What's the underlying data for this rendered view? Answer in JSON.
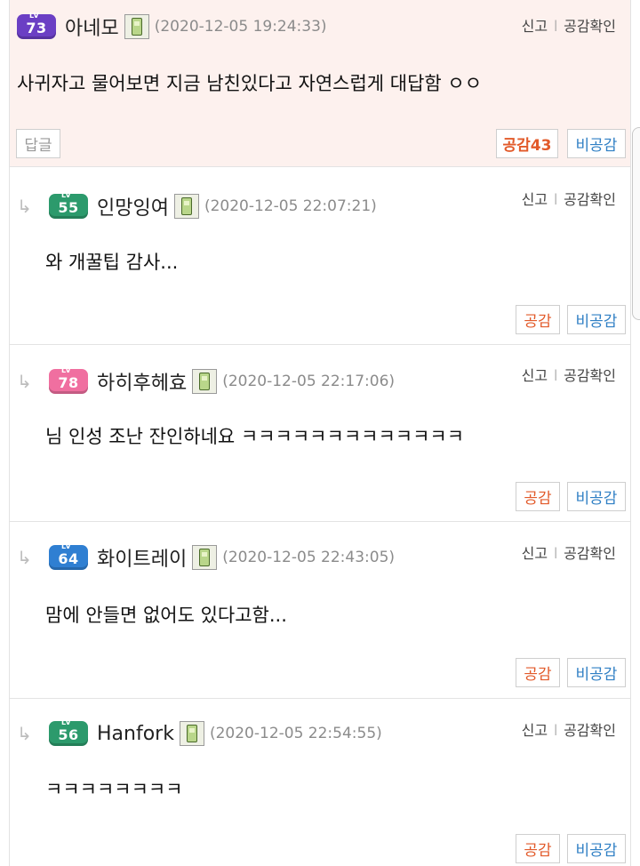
{
  "comments": [
    {
      "level": "73",
      "level_color": "#6b3fc4",
      "nickname": "아네모",
      "date": "(2020-12-05 19:24:33)",
      "report": "신고",
      "sympathy_check": "공감확인",
      "text": "사귀자고 물어보면 지금 남친있다고 자연스럽게 대답함 ㅇㅇ",
      "reply_btn": "답글",
      "like": "공감43",
      "dislike": "비공감"
    },
    {
      "level": "55",
      "level_color": "#2c9a6c",
      "nickname": "인망잉여",
      "date": "(2020-12-05 22:07:21)",
      "report": "신고",
      "sympathy_check": "공감확인",
      "text": "와 개꿀팁 감사...",
      "like": "공감",
      "dislike": "비공감"
    },
    {
      "level": "78",
      "level_color": "#f06fa0",
      "nickname": "하히후헤효",
      "date": "(2020-12-05 22:17:06)",
      "report": "신고",
      "sympathy_check": "공감확인",
      "text": "님 인성 조난 잔인하네요 ㅋㅋㅋㅋㅋㅋㅋㅋㅋㅋㅋㅋㅋ",
      "like": "공감",
      "dislike": "비공감"
    },
    {
      "level": "64",
      "level_color": "#2f7fd2",
      "nickname": "화이트레이",
      "date": "(2020-12-05 22:43:05)",
      "report": "신고",
      "sympathy_check": "공감확인",
      "text": "맘에 안들면 없어도 있다고함...",
      "like": "공감",
      "dislike": "비공감"
    },
    {
      "level": "56",
      "level_color": "#2c9a6c",
      "nickname": "Hanfork",
      "date": "(2020-12-05 22:54:55)",
      "report": "신고",
      "sympathy_check": "공감확인",
      "text": "ㅋㅋㅋㅋㅋㅋㅋㅋ",
      "like": "공감",
      "dislike": "비공감"
    }
  ],
  "icons": {
    "reply_arrow": "reply-arrow-icon",
    "phone": "mobile-phone-icon"
  }
}
